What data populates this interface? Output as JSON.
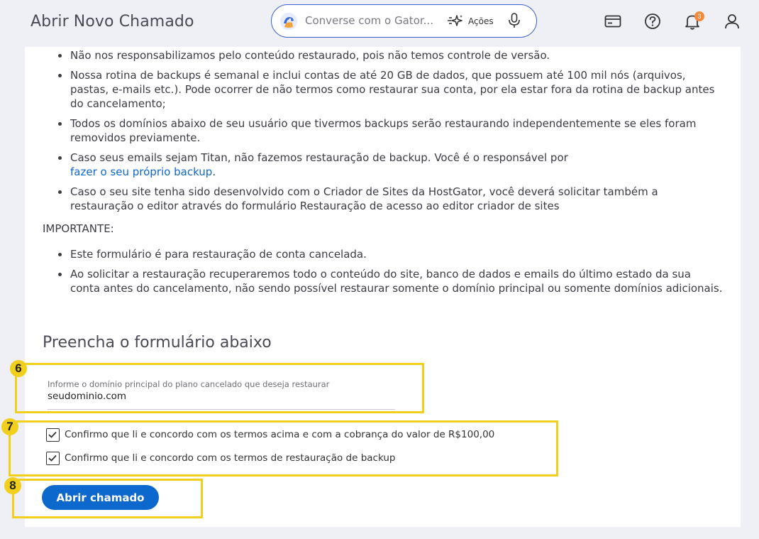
{
  "header": {
    "title": "Abrir Novo Chamado",
    "search_placeholder": "Converse com o Gator...",
    "actions_label": "Ações",
    "notifications_count": "3"
  },
  "info": {
    "bullets": [
      {
        "text": "Não nos responsabilizamos pelo conteúdo restaurado, pois não temos controle de versão."
      },
      {
        "text": "Nossa rotina de backups é semanal e inclui contas de até 20 GB de dados, que possuem até 100 mil nós (arquivos, pastas, e-mails etc.). Pode ocorrer de não termos como restaurar sua conta, por ela estar fora da rotina de backup antes do cancelamento;"
      },
      {
        "text": "Todos os domínios abaixo de seu usuário que tivermos backups serão restaurando independentemente se eles foram removidos previamente."
      },
      {
        "text": "Caso seus emails sejam Titan, não fazemos restauração de backup. Você é o responsável por",
        "link": "fazer o seu próprio backup",
        "after": "."
      },
      {
        "text": "Caso o seu site tenha sido desenvolvido com o Criador de Sites da HostGator, você deverá solicitar também a restauração o editor através do formulário Restauração de acesso ao editor criador de sites"
      }
    ],
    "important_label": "IMPORTANTE:",
    "important_bullets": [
      {
        "text": "Este formulário é para restauração de conta cancelada."
      },
      {
        "text": "Ao solicitar a restauração recuperaremos todo o conteúdo do site, banco de dados e emails do último estado da sua conta antes do cancelamento, não sendo possível restaurar somente o domínio principal ou somente domínios adicionais."
      }
    ]
  },
  "form": {
    "heading": "Preencha o formulário abaixo",
    "domain_label": "Informe o domínio principal do plano cancelado que deseja restaurar",
    "domain_value": "seudominio.com",
    "checkbox1_label": "Confirmo que li e concordo com os termos acima e com a cobrança do valor de R$100,00",
    "checkbox2_label": "Confirmo que li e concordo com os termos de restauração de backup",
    "checkbox1_checked": true,
    "checkbox2_checked": true,
    "submit_label": "Abrir chamado"
  },
  "annotations": {
    "step6": "6",
    "step7": "7",
    "step8": "8",
    "highlight_color": "#f1cf1a"
  },
  "colors": {
    "accent": "#0d68cd",
    "link": "#0f68c9",
    "search_border": "#3d5fd1",
    "badge": "#f28a3c"
  },
  "icons": [
    "gator-avatar-icon",
    "sparkle-icon",
    "microphone-icon",
    "credit-card-icon",
    "help-circle-icon",
    "bell-icon",
    "user-icon",
    "checkmark-icon"
  ]
}
